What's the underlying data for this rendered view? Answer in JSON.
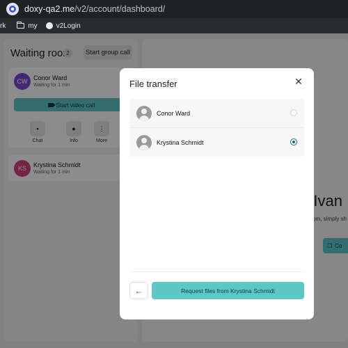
{
  "browser": {
    "url_host": "doxy-qa2.me",
    "url_path": "/v2/account/dashboard/",
    "bookmarks": [
      {
        "label": "rk",
        "icon": "none"
      },
      {
        "label": "my",
        "icon": "folder-icon"
      },
      {
        "label": "v2Login",
        "icon": "globe-icon"
      }
    ]
  },
  "waiting_room": {
    "title": "Waiting room",
    "count": "2",
    "group_call_label": "Start group call",
    "patients": [
      {
        "initials": "CW",
        "name": "Conor Ward",
        "status": "Waiting for 1 min",
        "avatar_color": "#7b4bd1"
      },
      {
        "initials": "KS",
        "name": "Krystina Schmidt",
        "status": "Waiting for 1 min",
        "avatar_color": "#d63f7f"
      }
    ],
    "video_call_label": "Start video call",
    "actions": [
      {
        "label": "Chat",
        "icon": "chat-icon"
      },
      {
        "label": "Info",
        "icon": "info-icon"
      },
      {
        "label": "More",
        "icon": "more-icon"
      }
    ]
  },
  "main": {
    "title_fragment": "e Ivan",
    "subtitle_fragment": "om, simply sh",
    "button_fragment": "Co"
  },
  "modal": {
    "title": "File transfer",
    "close_icon": "close-icon",
    "options": [
      {
        "name": "Conor Ward",
        "selected": false
      },
      {
        "name": "Krystina Schmidt",
        "selected": true
      }
    ],
    "back_icon": "arrow-left-icon",
    "request_label": "Request files from Krystina Schmidt",
    "accent_color": "#5fc6c8"
  }
}
